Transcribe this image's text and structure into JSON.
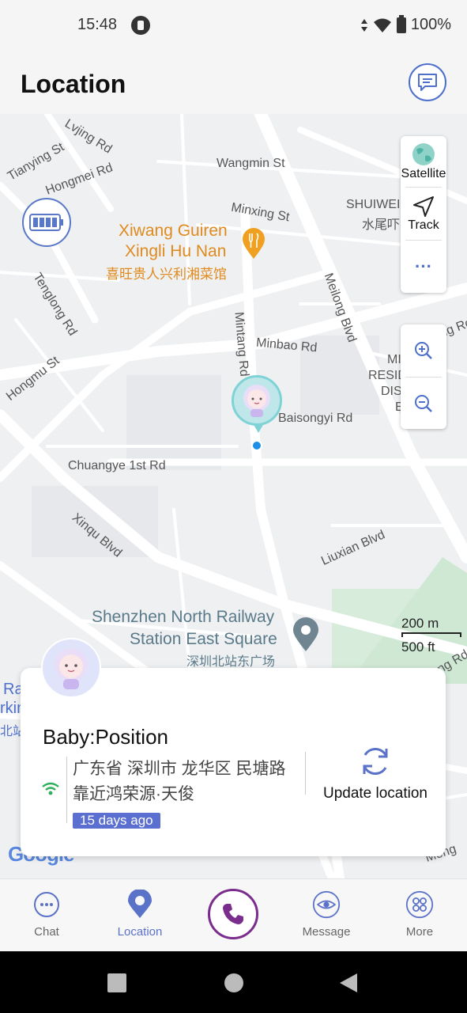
{
  "status_bar": {
    "time": "15:48",
    "battery": "100%"
  },
  "header": {
    "title": "Location",
    "chat_icon": "chat-bubble-icon"
  },
  "map": {
    "streets": [
      "Lvjing Rd",
      "Tianying St",
      "Hongmei Rd",
      "Wangmin St",
      "Minxing St",
      "Tenglong Rd",
      "Hongmu St",
      "Mintang Rd",
      "Meilong Blvd",
      "Minbao Rd",
      "Baisongyi Rd",
      "Chuangye 1st Rd",
      "Xinqu Blvd",
      "Liuxian Blvd"
    ],
    "poi_restaurant": {
      "line1": "Xiwang Guiren",
      "line2": "Xingli Hu Nan",
      "line3": "喜旺贵人兴利湘菜馆"
    },
    "poi_station": {
      "line1": "Shenzhen North Railway",
      "line2": "Station East Square",
      "line3": "深圳北站东广场"
    },
    "partial_labels": {
      "shuiwei_en": "SHUIWEI",
      "shuiwei_cn": "水尾吓",
      "mi": "MI",
      "resid": "RESID",
      "dis": "DIS",
      "e": "E",
      "ng_rd_top": "ng Rd",
      "ng_rd_bottom": "ng Rd",
      "ra": "Ra",
      "rkin": "rkin",
      "cn_bei": "北站",
      "meng": "Meng"
    },
    "scale": {
      "metric": "200 m",
      "imperial": "500 ft"
    },
    "attribution": "Google",
    "accent_color": "#4e70cc"
  },
  "toolbar": {
    "satellite": "Satellite",
    "track": "Track",
    "more": "···"
  },
  "card": {
    "title": "Baby:Position",
    "address": "广东省 深圳市 龙华区 民塘路 靠近鸿荣源·天俊",
    "age": "15 days ago",
    "update_label": "Update location"
  },
  "nav": {
    "items": [
      {
        "label": "Chat"
      },
      {
        "label": "Location"
      },
      {
        "label": ""
      },
      {
        "label": "Message"
      },
      {
        "label": "More"
      }
    ],
    "active_color": "#5b72c9",
    "call_color": "#7a2d8c"
  }
}
